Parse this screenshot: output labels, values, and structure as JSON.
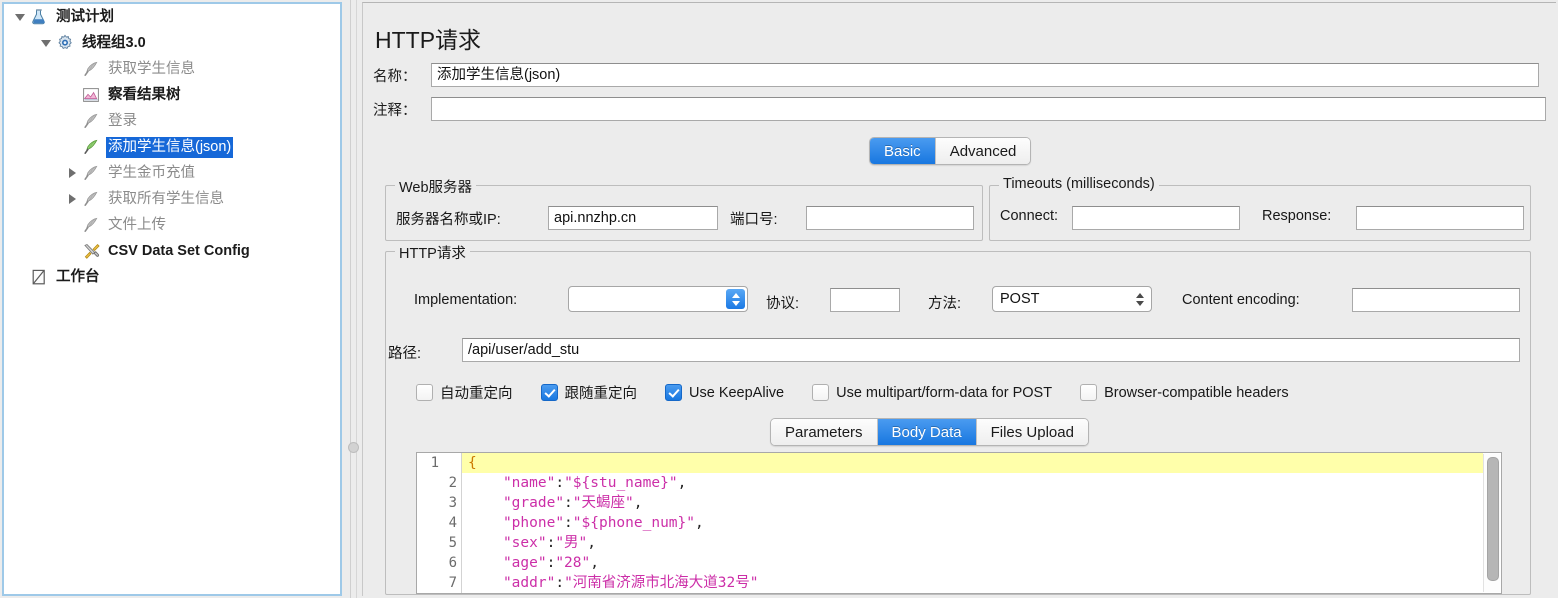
{
  "tree": {
    "items": [
      {
        "label": "测试计划",
        "icon": "flask-icon",
        "indent": 0,
        "twisty": "down",
        "state": "bold"
      },
      {
        "label": "线程组3.0",
        "icon": "gear-icon",
        "indent": 1,
        "twisty": "down",
        "state": "bold"
      },
      {
        "label": "获取学生信息",
        "icon": "feather-grey-icon",
        "indent": 2,
        "twisty": "none",
        "state": "dim"
      },
      {
        "label": "察看结果树",
        "icon": "result-tree-icon",
        "indent": 2,
        "twisty": "none",
        "state": "bold"
      },
      {
        "label": "登录",
        "icon": "feather-grey-icon",
        "indent": 2,
        "twisty": "none",
        "state": "dim"
      },
      {
        "label": "添加学生信息(json)",
        "icon": "feather-green-icon",
        "indent": 2,
        "twisty": "none",
        "state": "selected"
      },
      {
        "label": "学生金币充值",
        "icon": "feather-grey-icon",
        "indent": 2,
        "twisty": "right",
        "state": "dim"
      },
      {
        "label": "获取所有学生信息",
        "icon": "feather-grey-icon",
        "indent": 2,
        "twisty": "right",
        "state": "dim"
      },
      {
        "label": "文件上传",
        "icon": "feather-grey-icon",
        "indent": 2,
        "twisty": "none",
        "state": "dim"
      },
      {
        "label": "CSV Data Set Config",
        "icon": "tools-icon",
        "indent": 2,
        "twisty": "none",
        "state": "bold"
      },
      {
        "label": "工作台",
        "icon": "workbench-icon",
        "indent": 0,
        "twisty": "none",
        "state": "bold"
      }
    ]
  },
  "header": {
    "title": "HTTP请求",
    "name_label": "名称：",
    "name_value": "添加学生信息(json)",
    "comment_label": "注释：",
    "comment_value": ""
  },
  "mode_tabs": {
    "items": [
      "Basic",
      "Advanced"
    ],
    "selected": "Basic",
    "accent": "#1877e0"
  },
  "web_server": {
    "title": "Web服务器",
    "server_label": "服务器名称或IP:",
    "server_value": "api.nnzhp.cn",
    "port_label": "端口号:",
    "port_value": ""
  },
  "timeouts": {
    "title": "Timeouts (milliseconds)",
    "connect_label": "Connect:",
    "connect_value": "",
    "response_label": "Response:",
    "response_value": ""
  },
  "http_request": {
    "title": "HTTP请求",
    "implementation_label": "Implementation:",
    "implementation_value": "",
    "protocol_label": "协议:",
    "protocol_value": "",
    "method_label": "方法:",
    "method_value": "POST",
    "content_encoding_label": "Content encoding:",
    "content_encoding_value": "",
    "path_label": "路径:",
    "path_value": "/api/user/add_stu",
    "checkboxes": [
      {
        "label": "自动重定向",
        "checked": false
      },
      {
        "label": "跟随重定向",
        "checked": true
      },
      {
        "label": "Use KeepAlive",
        "checked": true
      },
      {
        "label": "Use multipart/form-data for POST",
        "checked": false
      },
      {
        "label": "Browser-compatible headers",
        "checked": false
      }
    ]
  },
  "body_tabs": {
    "items": [
      "Parameters",
      "Body Data",
      "Files Upload"
    ],
    "selected": "Body Data"
  },
  "code": {
    "lines": [
      {
        "n": "1",
        "fold": true,
        "highlight": true,
        "text": "{"
      },
      {
        "n": "2",
        "fold": false,
        "highlight": false,
        "text": "    \"name\":\"${stu_name}\","
      },
      {
        "n": "3",
        "fold": false,
        "highlight": false,
        "text": "    \"grade\":\"天蝎座\","
      },
      {
        "n": "4",
        "fold": false,
        "highlight": false,
        "text": "    \"phone\":\"${phone_num}\","
      },
      {
        "n": "5",
        "fold": false,
        "highlight": false,
        "text": "    \"sex\":\"男\","
      },
      {
        "n": "6",
        "fold": false,
        "highlight": false,
        "text": "    \"age\":\"28\","
      },
      {
        "n": "7",
        "fold": false,
        "highlight": false,
        "text": "    \"addr\":\"河南省济源市北海大道32号\""
      }
    ]
  }
}
